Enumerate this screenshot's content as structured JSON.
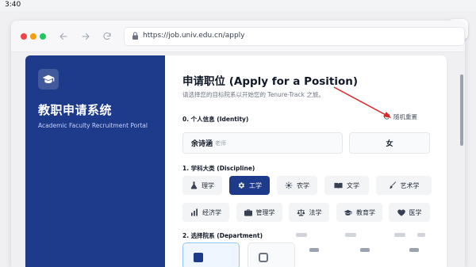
{
  "status_bar": {
    "time": "3:40"
  },
  "browser": {
    "url": "https://job.univ.edu.cn/apply"
  },
  "sidebar": {
    "title": "教职申请系统",
    "subtitle": "Academic Faculty Recruitment Portal"
  },
  "main": {
    "heading": "申请职位 (Apply for a Position)",
    "lead": "请选择您的目标院系以开始您的 Tenure-Track 之旅。",
    "identity": {
      "section_label": "0. 个人信息 (Identity)",
      "reset_label": "随机重置",
      "name": "余诗涵",
      "name_tag": "老师",
      "gender": "女"
    },
    "discipline": {
      "section_label": "1. 学科大类 (Discipline)",
      "selected": "工学",
      "row1": [
        {
          "label": "理学",
          "icon": "flask-icon"
        },
        {
          "label": "工学",
          "icon": "gear-icon"
        },
        {
          "label": "农学",
          "icon": "sun-icon"
        },
        {
          "label": "文学",
          "icon": "book-icon"
        },
        {
          "label": "艺术学",
          "icon": "brush-icon"
        }
      ],
      "row2": [
        {
          "label": "经济学",
          "icon": "bar-chart-icon"
        },
        {
          "label": "管理学",
          "icon": "briefcase-icon"
        },
        {
          "label": "法学",
          "icon": "scale-icon"
        },
        {
          "label": "教育学",
          "icon": "graduation-cap-icon"
        },
        {
          "label": "医学",
          "icon": "heart-icon"
        }
      ]
    },
    "department": {
      "section_label": "2. 选择院系 (Department)"
    }
  },
  "colors": {
    "sidebar": "#1e3a8a",
    "accent": "#1e3a8a",
    "chip_bg": "#f3f4f6",
    "annotation_arrow": "#dc2626"
  }
}
